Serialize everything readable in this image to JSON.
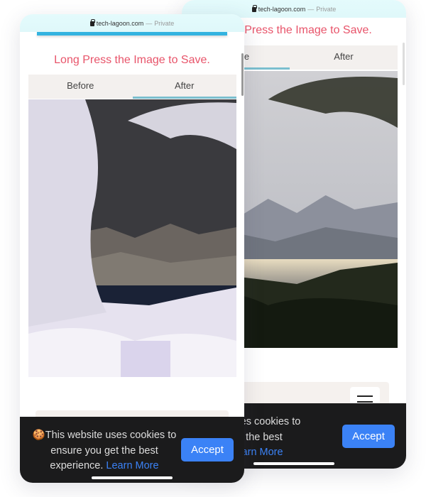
{
  "browser": {
    "domain": "tech-lagoon.com",
    "separator": "—",
    "mode": "Private"
  },
  "page": {
    "title": "Long Press the Image to Save.",
    "tabs": [
      {
        "label": "Before"
      },
      {
        "label": "After"
      }
    ]
  },
  "back_screen": {
    "active_tab": "Before",
    "image": "original lake landscape photo"
  },
  "front_screen": {
    "active_tab": "After",
    "image": "color-inverted lake landscape photo"
  },
  "cookie": {
    "icon": "cookie-icon",
    "text": "This website uses cookies to ensure you get the best experience.",
    "link": "Learn More",
    "accept": "Accept"
  },
  "colors": {
    "title": "#e8546a",
    "accept": "#3b82f6",
    "tab_underline": "#7bbfcf",
    "banner": "#1b1b1c"
  }
}
